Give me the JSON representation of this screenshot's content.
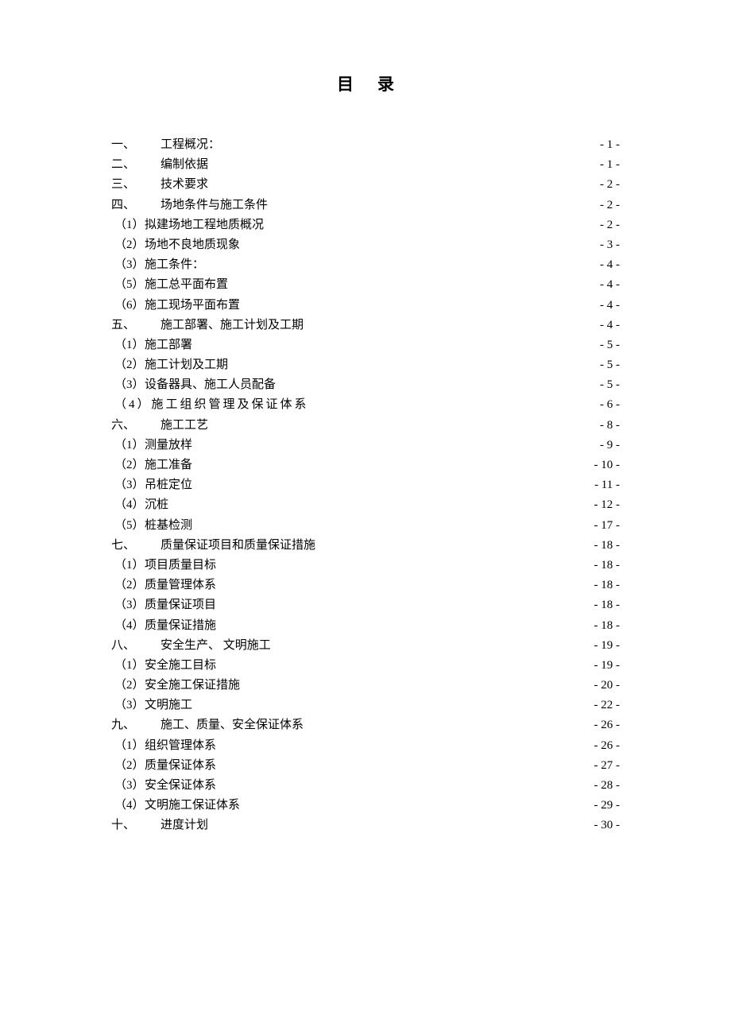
{
  "title": "目录",
  "toc": [
    {
      "level": 0,
      "label": "一、",
      "text": "工程概况：",
      "page": "- 1 -",
      "spaced": false
    },
    {
      "level": 0,
      "label": "二、",
      "text": "编制依据",
      "page": "- 1 -",
      "spaced": false
    },
    {
      "level": 0,
      "label": "三、",
      "text": "技术要求",
      "page": "- 2 -",
      "spaced": false
    },
    {
      "level": 0,
      "label": "四、",
      "text": "场地条件与施工条件",
      "page": "- 2 -",
      "spaced": false
    },
    {
      "level": 1,
      "label": "（1）",
      "text": "拟建场地工程地质概况",
      "page": "- 2 -",
      "spaced": false
    },
    {
      "level": 1,
      "label": "（2）",
      "text": "场地不良地质现象",
      "page": "- 3 -",
      "spaced": false
    },
    {
      "level": 1,
      "label": "（3）",
      "text": "施工条件：",
      "page": "- 4 -",
      "spaced": false
    },
    {
      "level": 1,
      "label": "（5）",
      "text": "施工总平面布置",
      "page": "- 4 -",
      "spaced": false
    },
    {
      "level": 1,
      "label": "（6）",
      "text": "施工现场平面布置",
      "page": "- 4 -",
      "spaced": false
    },
    {
      "level": 0,
      "label": "五、",
      "text": "施工部署、施工计划及工期",
      "page": "- 4 -",
      "spaced": false
    },
    {
      "level": 1,
      "label": "（1）",
      "text": "施工部署",
      "page": "- 5 -",
      "spaced": false
    },
    {
      "level": 1,
      "label": "（2）",
      "text": "施工计划及工期",
      "page": "- 5 -",
      "spaced": false
    },
    {
      "level": 1,
      "label": "（3）",
      "text": "设备器具、施工人员配备",
      "page": "- 5 -",
      "spaced": false
    },
    {
      "level": 1,
      "label": "（4）",
      "text": "施工组织管理及保证体系",
      "page": "- 6 -",
      "spaced": true
    },
    {
      "level": 0,
      "label": "六、",
      "text": "施工工艺",
      "page": "- 8 -",
      "spaced": false
    },
    {
      "level": 1,
      "label": "（1）",
      "text": "测量放样",
      "page": "- 9 -",
      "spaced": false
    },
    {
      "level": 1,
      "label": "（2）",
      "text": "施工准备",
      "page": "- 10 -",
      "spaced": false
    },
    {
      "level": 1,
      "label": "（3）",
      "text": "吊桩定位",
      "page": "- 11 -",
      "spaced": false
    },
    {
      "level": 1,
      "label": "（4）",
      "text": "沉桩",
      "page": "- 12 -",
      "spaced": false
    },
    {
      "level": 1,
      "label": "（5）",
      "text": "桩基检测",
      "page": "- 17 -",
      "spaced": false
    },
    {
      "level": 0,
      "label": "七、",
      "text": "质量保证项目和质量保证措施",
      "page": "- 18 -",
      "spaced": false
    },
    {
      "level": 1,
      "label": "（1）",
      "text": "项目质量目标",
      "page": "- 18 -",
      "spaced": false
    },
    {
      "level": 1,
      "label": "（2）",
      "text": "质量管理体系",
      "page": "- 18 -",
      "spaced": false
    },
    {
      "level": 1,
      "label": "（3）",
      "text": "质量保证项目",
      "page": "- 18 -",
      "spaced": false
    },
    {
      "level": 1,
      "label": "（4）",
      "text": "质量保证措施",
      "page": "- 18 -",
      "spaced": false
    },
    {
      "level": 0,
      "label": "八、",
      "text": "安全生产、 文明施工",
      "page": "- 19 -",
      "spaced": false
    },
    {
      "level": 1,
      "label": "（1）",
      "text": "安全施工目标",
      "page": "- 19 -",
      "spaced": false
    },
    {
      "level": 1,
      "label": "（2）",
      "text": "安全施工保证措施",
      "page": "- 20 -",
      "spaced": false
    },
    {
      "level": 1,
      "label": "（3）",
      "text": "文明施工",
      "page": "- 22 -",
      "spaced": false
    },
    {
      "level": 0,
      "label": "九、",
      "text": "施工、质量、安全保证体系",
      "page": "- 26 -",
      "spaced": false
    },
    {
      "level": 1,
      "label": "（1）",
      "text": "组织管理体系",
      "page": "- 26 -",
      "spaced": false
    },
    {
      "level": 1,
      "label": "（2）",
      "text": "质量保证体系",
      "page": "- 27 -",
      "spaced": false
    },
    {
      "level": 1,
      "label": "（3）",
      "text": "安全保证体系",
      "page": "- 28 -",
      "spaced": false
    },
    {
      "level": 1,
      "label": "（4）",
      "text": "文明施工保证体系",
      "page": "- 29 -",
      "spaced": false
    },
    {
      "level": 0,
      "label": "十、",
      "text": "进度计划",
      "page": "- 30 -",
      "spaced": false
    }
  ]
}
